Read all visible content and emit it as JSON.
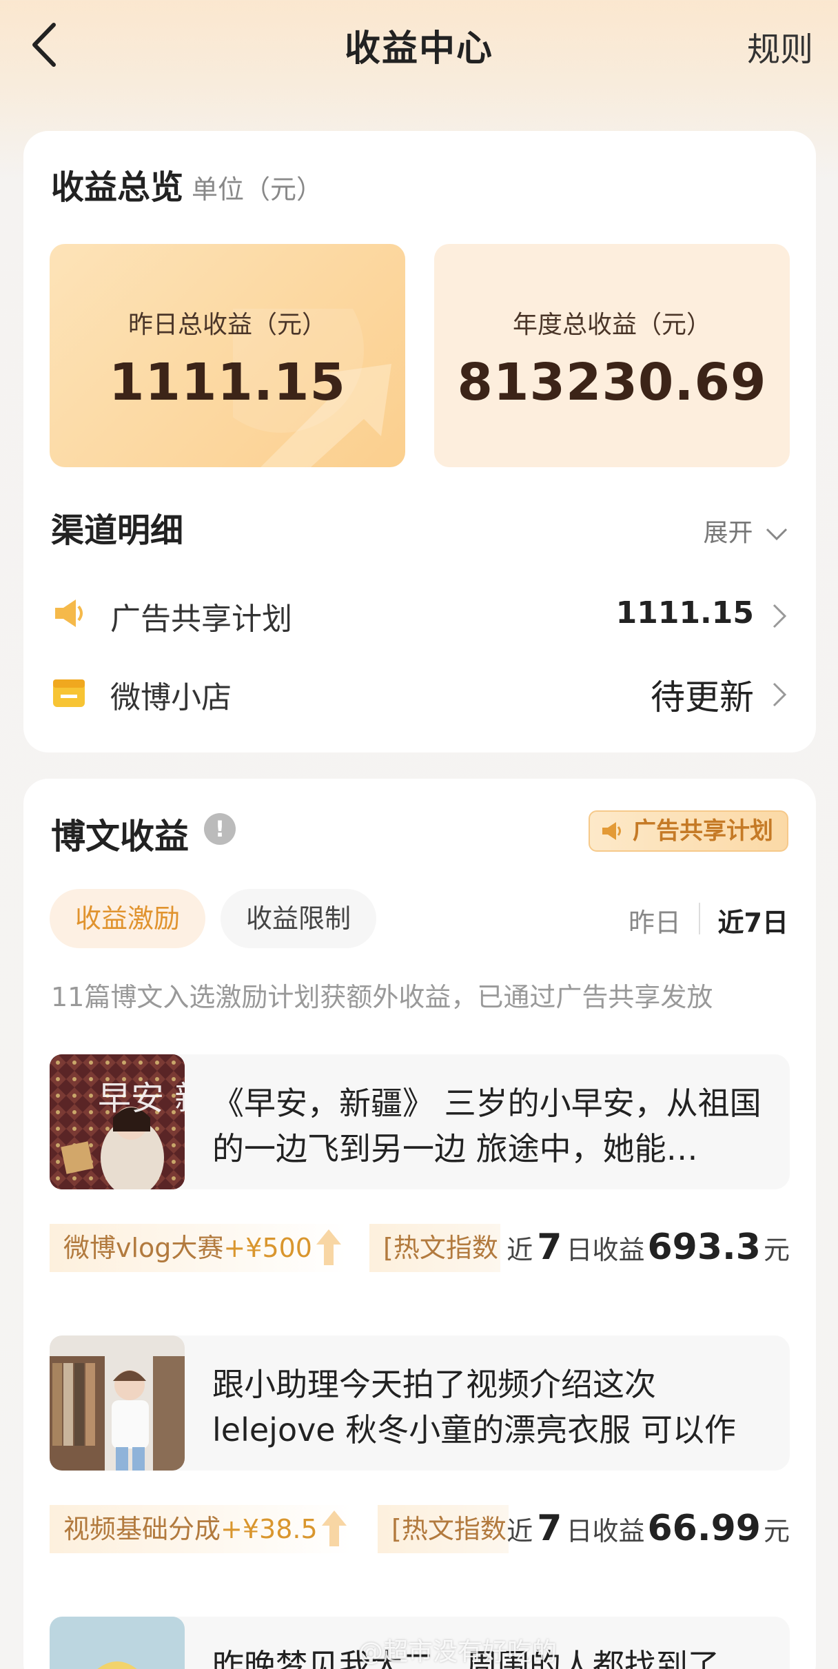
{
  "nav": {
    "title": "收益中心",
    "rule_label": "规则"
  },
  "overview": {
    "title": "收益总览",
    "unit": "单位（元）",
    "yesterday_label": "昨日总收益（元）",
    "yesterday_value": "1111.15",
    "annual_label": "年度总收益（元）",
    "annual_value": "813230.69"
  },
  "channels": {
    "title": "渠道明细",
    "expand_label": "展开",
    "items": [
      {
        "name": "广告共享计划",
        "value": "1111.15",
        "icon": "megaphone-icon"
      },
      {
        "name": "微博小店",
        "value": "待更新",
        "icon": "shop-icon"
      }
    ]
  },
  "bowen": {
    "title": "博文收益",
    "ad_badge": "广告共享计划",
    "tabs": [
      {
        "label": "收益激励",
        "active": true
      },
      {
        "label": "收益限制",
        "active": false
      }
    ],
    "ranges": [
      {
        "label": "昨日"
      },
      {
        "label": "近7日",
        "active": true
      }
    ],
    "note": "11篇博文入选激励计划获额外收益，已通过广告共享发放",
    "posts": [
      {
        "text": "《早安，新疆》 三岁的小早安，从祖国的一边飞到另一边 旅途中，她能…",
        "thumb_text": "早安 新疆",
        "tag1_name": "微博vlog大赛",
        "tag1_bonus": "+¥500",
        "tag2": "[热文指数",
        "earn_prefix": "近",
        "earn_days": "7",
        "earn_mid": "日收益",
        "earn_value": "693.3",
        "earn_unit": "元"
      },
      {
        "text": "跟小助理今天拍了视频介绍这次lelejove 秋冬小童的漂亮衣服 可以作为…",
        "tag1_name": "视频基础分成",
        "tag1_bonus": "+¥38.5",
        "tag2": "[热文指数",
        "earn_prefix": "近",
        "earn_days": "7",
        "earn_mid": "日收益",
        "earn_value": "66.99",
        "earn_unit": "元"
      },
      {
        "text": "昨晚梦见我大二，周围的人都找到了"
      }
    ]
  },
  "watermark": "@超市没有好吃的",
  "colors": {
    "accent": "#e0932e",
    "brown": "#3c2418"
  }
}
